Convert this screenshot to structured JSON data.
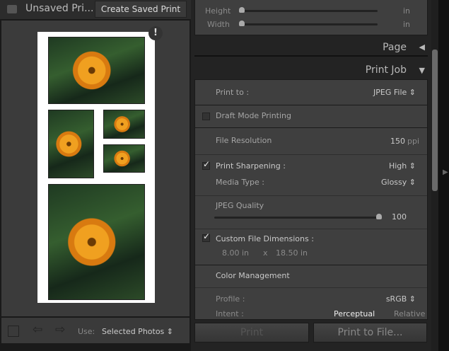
{
  "left": {
    "title": "Unsaved Pri...",
    "create_saved_print": "Create Saved Print",
    "warning": "!",
    "use_label": "Use:",
    "use_value": "Selected Photos"
  },
  "right": {
    "image_settings": {
      "height_label": "Height",
      "height_unit": "in",
      "width_label": "Width",
      "width_unit": "in"
    },
    "page_header": "Page",
    "print_job_header": "Print Job",
    "print_to_label": "Print to :",
    "print_to_value": "JPEG File",
    "draft_mode": "Draft Mode Printing",
    "draft_checked": false,
    "file_resolution_label": "File Resolution",
    "file_resolution_value": "150",
    "file_resolution_unit": "ppi",
    "print_sharpening_label": "Print Sharpening :",
    "print_sharpening_checked": true,
    "print_sharpening_value": "High",
    "media_type_label": "Media Type :",
    "media_type_value": "Glossy",
    "jpeg_quality_label": "JPEG Quality",
    "jpeg_quality_value": "100",
    "custom_dims_label": "Custom File Dimensions :",
    "custom_dims_checked": true,
    "dim_width": "8.00 in",
    "dim_x": "x",
    "dim_height": "18.50 in",
    "color_management": "Color Management",
    "profile_label": "Profile :",
    "profile_value": "sRGB",
    "intent_label": "Intent :",
    "intent_perceptual": "Perceptual",
    "intent_relative": "Relative",
    "print_button": "Print",
    "print_to_file_button": "Print to File..."
  }
}
